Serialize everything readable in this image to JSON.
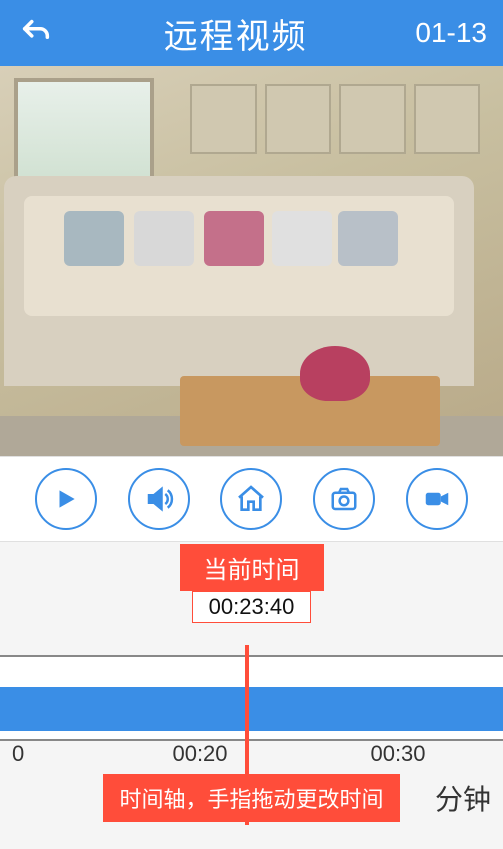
{
  "header": {
    "title": "远程视频",
    "date": "01-13"
  },
  "controls": {
    "play": "play",
    "sound": "sound",
    "home": "home",
    "camera": "camera",
    "video": "video"
  },
  "timeline": {
    "current_label": "当前时间",
    "current_value": "00:23:40",
    "ticks": {
      "t0": "0",
      "t20": "00:20",
      "t30": "00:30"
    },
    "hint": "时间轴，手指拖动更改时间",
    "unit": "分钟"
  }
}
